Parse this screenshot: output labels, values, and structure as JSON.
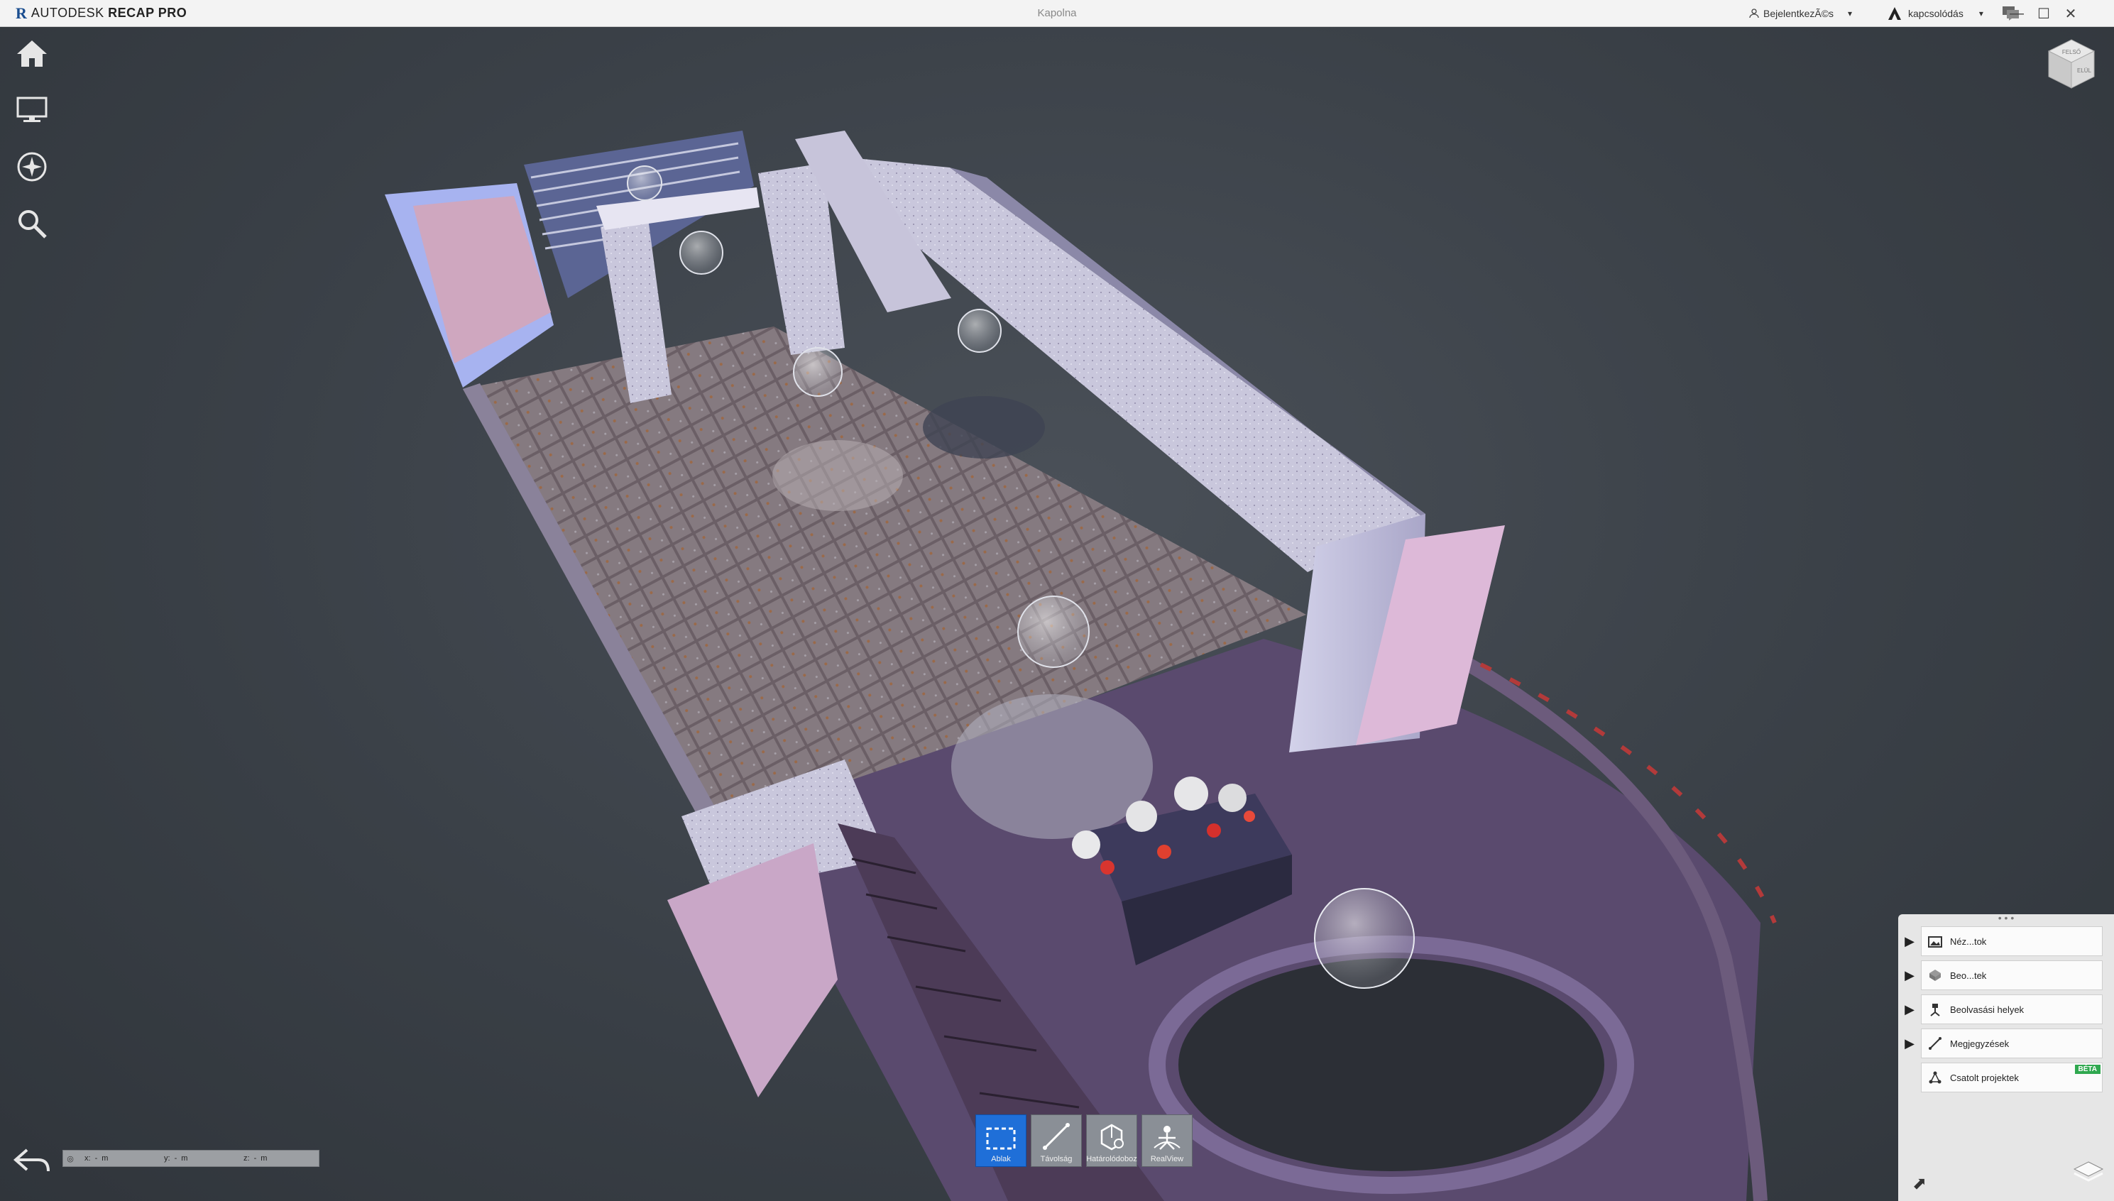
{
  "app": {
    "brand_mark": "R",
    "brand_prefix": "AUTODESK",
    "brand_product": "RECAP PRO",
    "document_title": "Kapolna"
  },
  "titlebar": {
    "signin_label": "BejelentkezÃ©s",
    "connect_label": "kapcsolódás",
    "minimize": "—",
    "maximize": "☐",
    "close": "✕"
  },
  "leftnav": {
    "icons": [
      "home-icon",
      "display-icon",
      "navigate-icon",
      "search-icon"
    ]
  },
  "viewcube": {
    "top_label": "FELSŐ",
    "front_label": "ELÜL"
  },
  "panel": {
    "grip": "• • •",
    "items": [
      {
        "label": "Néz...tok",
        "icon": "views-icon",
        "expandable": true
      },
      {
        "label": "Beo...tek",
        "icon": "scans-icon",
        "expandable": true
      },
      {
        "label": "Beolvasási helyek",
        "icon": "scan-locations-icon",
        "expandable": true
      },
      {
        "label": "Megjegyzések",
        "icon": "annotations-icon",
        "expandable": true
      },
      {
        "label": "Csatolt projektek",
        "icon": "linked-projects-icon",
        "expandable": false,
        "badge": "BÉTA"
      }
    ]
  },
  "toolbar": {
    "tools": [
      {
        "label": "Ablak",
        "icon": "window-select-icon",
        "active": true
      },
      {
        "label": "Távolság",
        "icon": "distance-icon",
        "active": false
      },
      {
        "label": "Határolódoboz",
        "icon": "limit-box-icon",
        "active": false
      },
      {
        "label": "RealView",
        "icon": "realview-icon",
        "active": false
      }
    ]
  },
  "coords": {
    "x_label": "x:",
    "x_value": "-",
    "x_unit": "m",
    "y_label": "y:",
    "y_value": "-",
    "y_unit": "m",
    "z_label": "z:",
    "z_value": "-",
    "z_unit": "m"
  },
  "colors": {
    "accent": "#1f6fd8",
    "beta_badge": "#2fa84f",
    "background": "#3b4148"
  }
}
